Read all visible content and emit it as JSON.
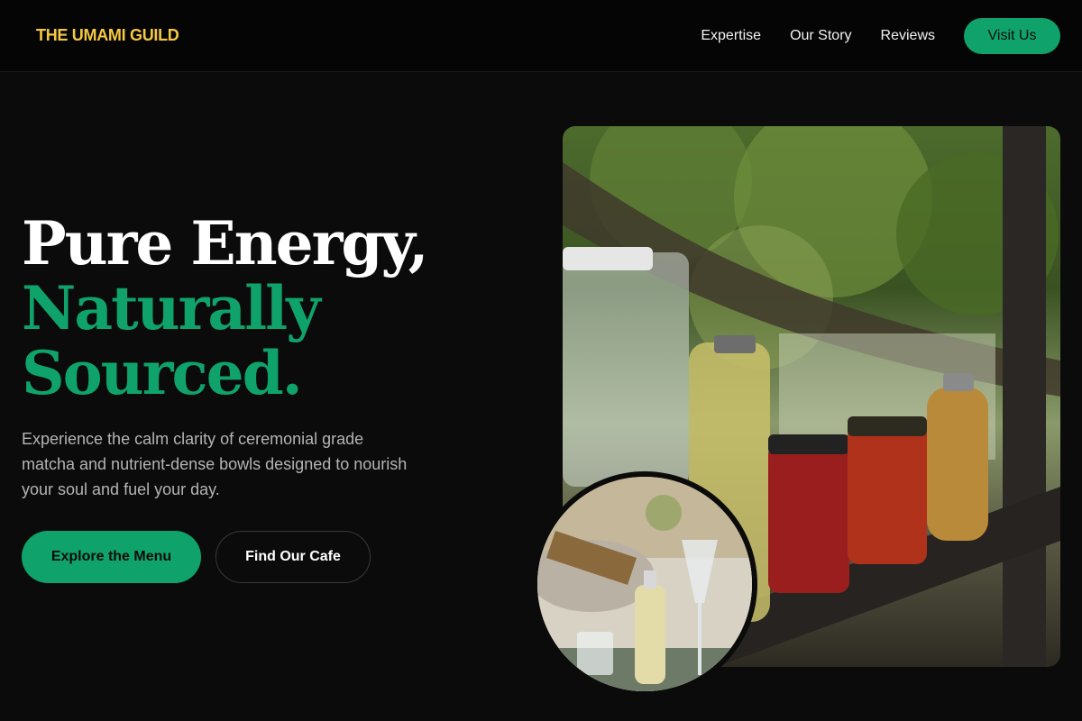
{
  "nav": {
    "logo": "THE UMAMI GUILD",
    "links": [
      "Expertise",
      "Our Story",
      "Reviews"
    ],
    "cta": "Visit Us"
  },
  "hero": {
    "heading_line1": "Pure Energy,",
    "heading_line2": "Naturally",
    "heading_line3": "Sourced.",
    "subtext": "Experience the calm clarity of ceremonial grade matcha and nutrient-dense bowls designed to nourish your soul and fuel your day.",
    "primary_button": "Explore the Menu",
    "secondary_button": "Find Our Cafe"
  },
  "colors": {
    "logo": "#f5c842",
    "accent": "#0fa36b",
    "background": "#0b0b0b"
  },
  "images": {
    "main": "jars-of-drinks-on-shelf-photo",
    "inset": "cafe-table-with-bottle-and-glass-photo"
  }
}
